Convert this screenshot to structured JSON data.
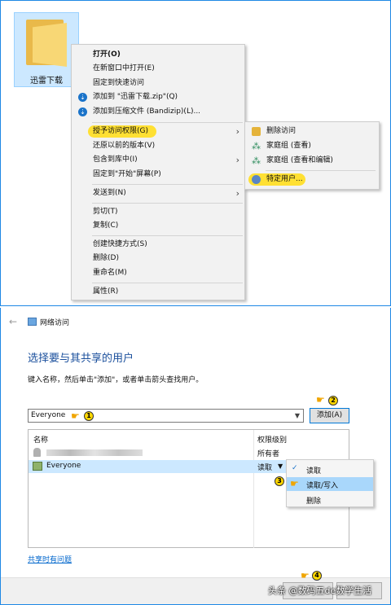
{
  "desktop": {
    "folder_label": "迅雷下载"
  },
  "context_menu": {
    "items": [
      {
        "label": "打开(O)"
      },
      {
        "label": "在新窗口中打开(E)"
      },
      {
        "label": "固定到快速访问"
      },
      {
        "label": "添加到 \"迅雷下载.zip\"(Q)"
      },
      {
        "label": "添加到压缩文件 (Bandizip)(L)..."
      },
      {
        "label": "授予访问权限(G)"
      },
      {
        "label": "还原以前的版本(V)"
      },
      {
        "label": "包含到库中(I)"
      },
      {
        "label": "固定到\"开始\"屏幕(P)"
      },
      {
        "label": "发送到(N)"
      },
      {
        "label": "剪切(T)"
      },
      {
        "label": "复制(C)"
      },
      {
        "label": "创建快捷方式(S)"
      },
      {
        "label": "删除(D)"
      },
      {
        "label": "重命名(M)"
      },
      {
        "label": "属性(R)"
      }
    ]
  },
  "submenu": {
    "items": [
      {
        "label": "删除访问"
      },
      {
        "label": "家庭组 (查看)"
      },
      {
        "label": "家庭组 (查看和编辑)"
      },
      {
        "label": "特定用户..."
      }
    ]
  },
  "dialog": {
    "title": "网络访问",
    "heading": "选择要与其共享的用户",
    "instruction": "键入名称，然后单击\"添加\"，或者单击箭头查找用户。",
    "input_value": "Everyone",
    "add_button": "添加(A)",
    "columns": {
      "name": "名称",
      "permission": "权限级别"
    },
    "rows": [
      {
        "name": "",
        "permission": "所有者"
      },
      {
        "name": "Everyone",
        "permission": "读取"
      }
    ],
    "perm_menu": [
      "读取",
      "读取/写入",
      "删除"
    ],
    "help_link": "共享时有问题",
    "steps": [
      "1",
      "2",
      "3",
      "4"
    ]
  },
  "watermark": "头条 @数码五de数学生活",
  "colors": {
    "accent": "#1e88e5",
    "highlight": "#ffe033",
    "selection": "#cce8ff"
  }
}
